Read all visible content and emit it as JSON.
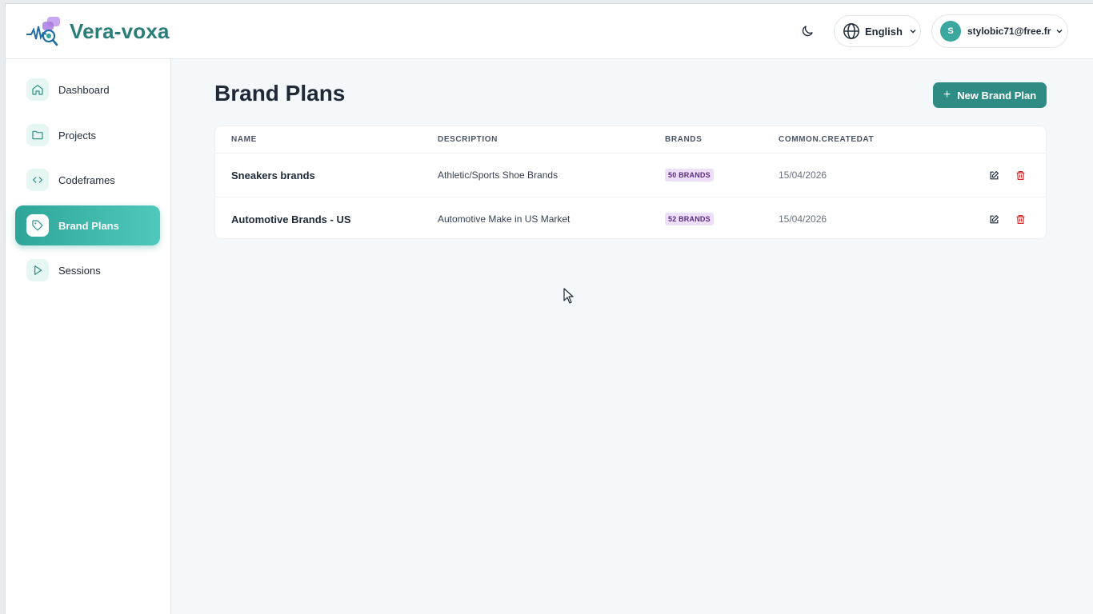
{
  "app": {
    "name": "Vera-voxa"
  },
  "header": {
    "language": "English",
    "user": {
      "initial": "S",
      "email": "stylobic71@free.fr"
    }
  },
  "sidebar": {
    "items": [
      {
        "label": "Dashboard",
        "icon": "home-icon",
        "active": false
      },
      {
        "label": "Projects",
        "icon": "folder-icon",
        "active": false
      },
      {
        "label": "Codeframes",
        "icon": "code-icon",
        "active": false
      },
      {
        "label": "Brand Plans",
        "icon": "tag-icon",
        "active": true
      },
      {
        "label": "Sessions",
        "icon": "play-icon",
        "active": false
      }
    ]
  },
  "main": {
    "title": "Brand Plans",
    "new_button_label": "New Brand Plan",
    "table": {
      "columns": [
        "NAME",
        "DESCRIPTION",
        "BRANDS",
        "COMMON.CREATEDAT"
      ],
      "rows": [
        {
          "name": "Sneakers brands",
          "description": "Athletic/Sports Shoe Brands",
          "brands": "50 BRANDS",
          "created_at": "15/04/2026"
        },
        {
          "name": "Automotive Brands - US",
          "description": "Automotive Make in US Market",
          "brands": "52 BRANDS",
          "created_at": "15/04/2026"
        }
      ]
    }
  },
  "colors": {
    "brand": "#2a7d78",
    "accent": "#2e8c85",
    "badge_bg": "#ecdff7",
    "badge_text": "#5b2a86",
    "delete": "#dc2626"
  }
}
